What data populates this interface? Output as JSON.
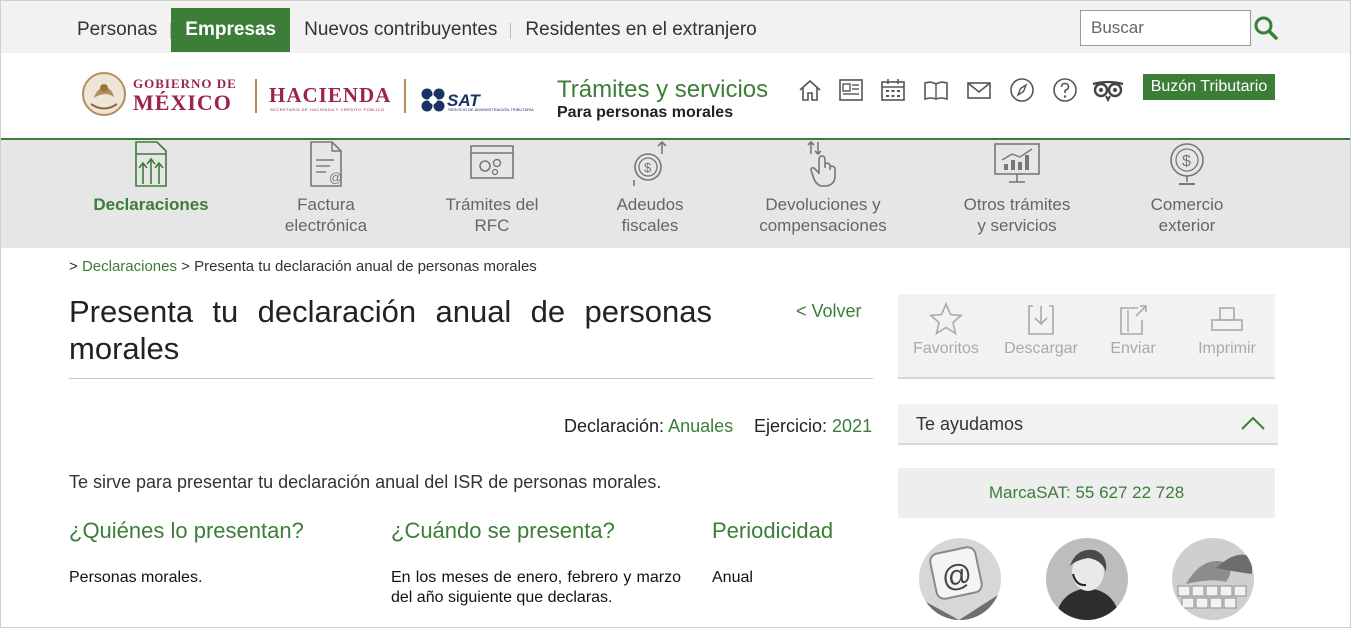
{
  "topnav": {
    "items": [
      {
        "label": "Personas"
      },
      {
        "label": "Empresas",
        "active": true
      },
      {
        "label": "Nuevos contribuyentes"
      },
      {
        "label": "Residentes en el extranjero"
      }
    ],
    "search_placeholder": "Buscar"
  },
  "header": {
    "gob_line1": "GOBIERNO DE",
    "gob_line2": "MÉXICO",
    "hacienda": "HACIENDA",
    "hacienda_sub": "SECRETARÍA DE HACIENDA Y CRÉDITO PÚBLICO",
    "sat": "SAT",
    "sat_sub": "SERVICIO DE ADMINISTRACIÓN TRIBUTARIA",
    "title": "Trámites y servicios",
    "subtitle": "Para personas morales",
    "icons": [
      "home-icon",
      "newspaper-icon",
      "calendar-icon",
      "book-icon",
      "mail-icon",
      "compass-icon",
      "help-icon",
      "owl-icon"
    ],
    "buzon": "Buzón Tributario"
  },
  "categories": [
    {
      "line1": "Declaraciones",
      "line2": "",
      "active": true,
      "icon": "declaraciones-icon"
    },
    {
      "line1": "Factura",
      "line2": "electrónica",
      "icon": "factura-icon"
    },
    {
      "line1": "Trámites del",
      "line2": "RFC",
      "icon": "rfc-icon"
    },
    {
      "line1": "Adeudos",
      "line2": "fiscales",
      "icon": "adeudos-icon"
    },
    {
      "line1": "Devoluciones y",
      "line2": "compensaciones",
      "icon": "devoluciones-icon"
    },
    {
      "line1": "Otros trámites",
      "line2": "y servicios",
      "icon": "otros-icon"
    },
    {
      "line1": "Comercio",
      "line2": "exterior",
      "icon": "comercio-icon"
    }
  ],
  "breadcrumb": {
    "prefix": ">",
    "link": "Declaraciones",
    "separator": ">",
    "current": "Presenta tu declaración anual de personas morales"
  },
  "page": {
    "title": "Presenta tu declaración anual de personas morales",
    "back": "< Volver",
    "declaracion_label": "Declaración:",
    "declaracion_value": "Anuales",
    "ejercicio_label": "Ejercicio:",
    "ejercicio_value": "2021",
    "intro": "Te sirve para presentar tu declaración anual del ISR de personas morales.",
    "columns": [
      {
        "heading": "¿Quiénes lo presentan?",
        "text": "Personas morales."
      },
      {
        "heading": "¿Cuándo se presenta?",
        "text": "En los meses de enero, febrero y marzo del año siguiente que declaras."
      },
      {
        "heading": "Periodicidad",
        "text": "Anual"
      }
    ]
  },
  "sidebar": {
    "actions": [
      {
        "label": "Favoritos",
        "icon": "star-icon"
      },
      {
        "label": "Descargar",
        "icon": "download-icon"
      },
      {
        "label": "Enviar",
        "icon": "send-icon"
      },
      {
        "label": "Imprimir",
        "icon": "print-icon"
      }
    ],
    "help_label": "Te ayudamos",
    "marca": "MarcaSAT: 55 627 22 728",
    "photos": [
      "email-photo",
      "agent-photo",
      "keyboard-photo"
    ]
  },
  "colors": {
    "green": "#3c7d38",
    "gob": "#9d2449",
    "gray_bar": "#f2f2f2",
    "nav_bg": "#e6e6e6"
  }
}
